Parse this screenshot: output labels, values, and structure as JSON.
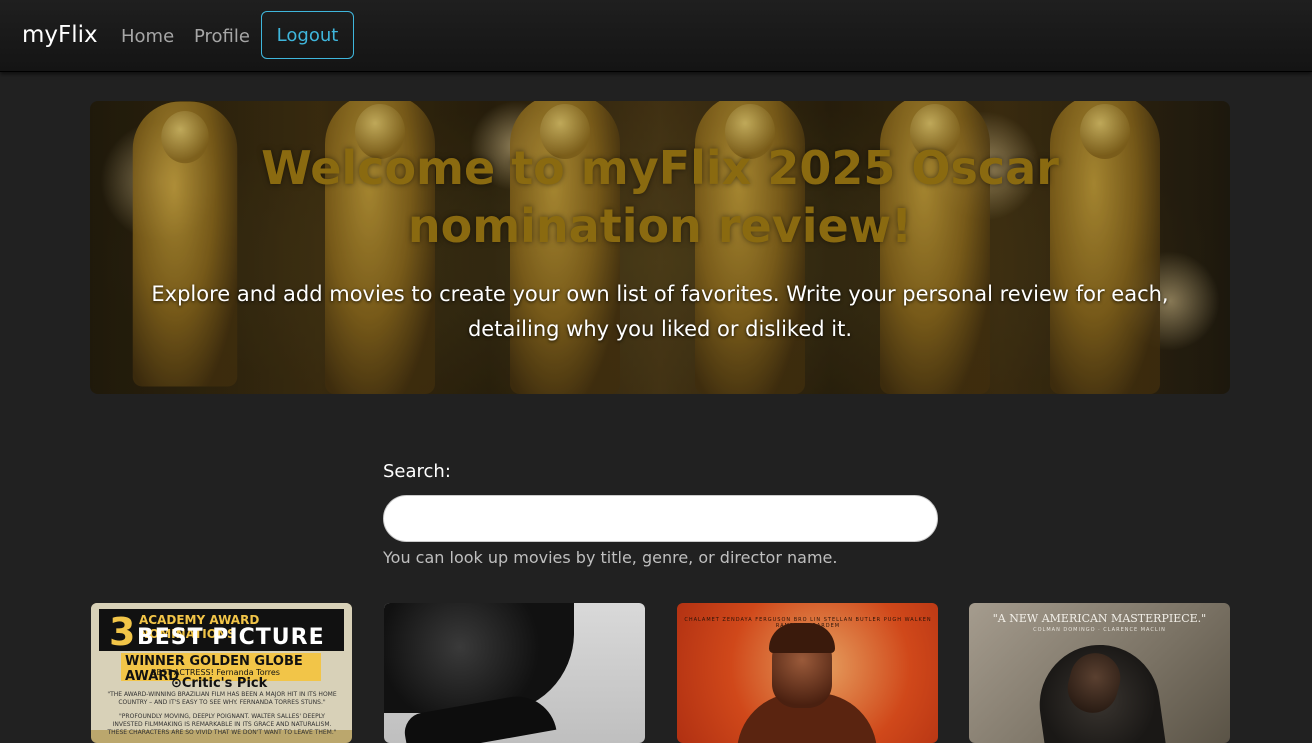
{
  "nav": {
    "brand": "myFlix",
    "home": "Home",
    "profile": "Profile",
    "logout": "Logout"
  },
  "hero": {
    "title": "Welcome to myFlix 2025 Oscar nomination review!",
    "subtitle": "Explore and add movies to create your own list of favorites. Write your personal review for each, detailing why you liked or disliked it."
  },
  "search": {
    "label": "Search:",
    "value": "",
    "help": "You can look up movies by title, genre, or director name."
  },
  "cards": [
    {
      "poster_text": {
        "count": "3",
        "nominations": "ACADEMY AWARD NOMINATIONS",
        "best_picture": "BEST PICTURE",
        "winner": "WINNER GOLDEN GLOBE AWARD",
        "best_actress": "BEST ACTRESS! Fernanda Torres",
        "critics_pick": "⊙Critic's Pick",
        "quote1": "\"THE AWARD-WINNING BRAZILIAN FILM HAS BEEN A MAJOR HIT IN ITS HOME COUNTRY – AND IT'S EASY TO SEE WHY. FERNANDA TORRES STUNS.\"",
        "quote2": "\"PROFOUNDLY MOVING, DEEPLY POIGNANT. WALTER SALLES' DEEPLY INVESTED FILMMAKING IS REMARKABLE IN ITS GRACE AND NATURALISM. THESE CHARACTERS ARE SO VIVID THAT WE DON'T WANT TO LEAVE THEM.\""
      }
    },
    {
      "poster_text": {}
    },
    {
      "poster_text": {
        "credits": "CHALAMET ZENDAYA FERGUSON BRO LIN STELLAN BUTLER PUGH WALKEN RAMPLING BARDEM"
      }
    },
    {
      "poster_text": {
        "quote": "\"A NEW AMERICAN MASTERPIECE.\"",
        "names": "COLMAN DOMINGO · CLARENCE MACLIN"
      }
    }
  ],
  "colors": {
    "background": "#212121",
    "accent": "#3fb6dc",
    "hero_title": "#8a6a10"
  }
}
